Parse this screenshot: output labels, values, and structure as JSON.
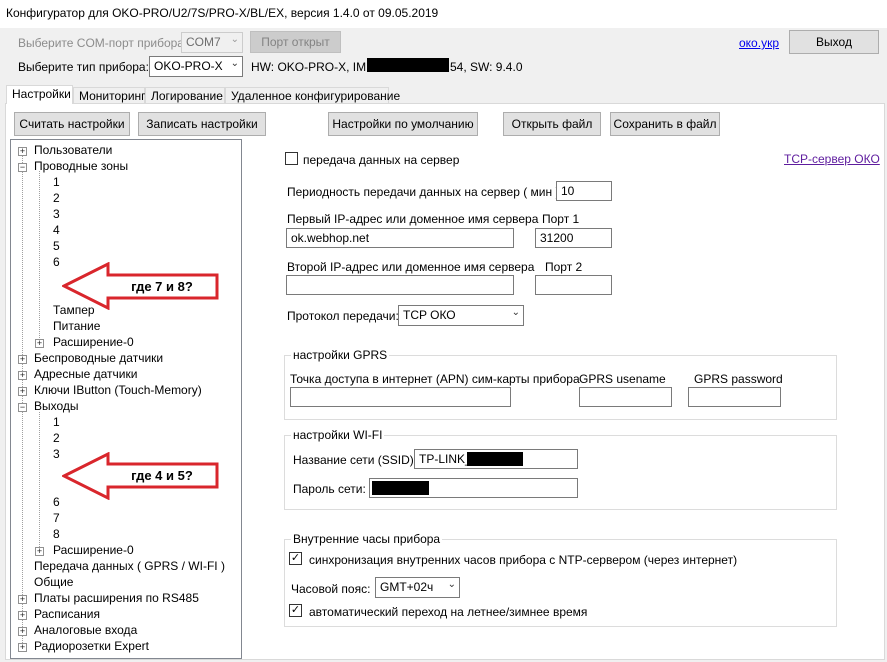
{
  "window": {
    "title": "Конфигуратор для OKO-PRO/U2/7S/PRO-X/BL/EX, версия 1.4.0 от 09.05.2019"
  },
  "header": {
    "com_label": "Выберите COM-порт прибора:",
    "com_value": "COM7",
    "port_button": "Порт открыт",
    "device_label": "Выберите тип прибора:",
    "device_value": "OKO-PRO-X",
    "hw_prefix": "HW: OKO-PRO-X, IMEI:",
    "hw_suffix": "54, SW: 9.4.0",
    "site_link": "око.укр",
    "exit_button": "Выход"
  },
  "tabs": [
    "Настройки",
    "Мониторинг",
    "Логирование",
    "Удаленное конфигурирование"
  ],
  "toolbar": {
    "read": "Считать настройки",
    "write": "Записать настройки",
    "defaults": "Настройки по умолчанию",
    "open": "Открыть файл",
    "save": "Сохранить в файл"
  },
  "tree": [
    {
      "label": "Пользователи",
      "expander": "+"
    },
    {
      "label": "Проводные зоны",
      "expander": "-"
    },
    {
      "label": "1"
    },
    {
      "label": "2"
    },
    {
      "label": "3"
    },
    {
      "label": "4"
    },
    {
      "label": "5"
    },
    {
      "label": "6"
    },
    {
      "label": ""
    },
    {
      "label": ""
    },
    {
      "label": "Тампер"
    },
    {
      "label": "Питание"
    },
    {
      "label": "Расширение-0",
      "expander": "+"
    },
    {
      "label": "Беспроводные датчики",
      "expander": "+"
    },
    {
      "label": "Адресные датчики",
      "expander": "+"
    },
    {
      "label": "Ключи IButton (Touch-Memory)",
      "expander": "+"
    },
    {
      "label": "Выходы",
      "expander": "-"
    },
    {
      "label": "1"
    },
    {
      "label": "2"
    },
    {
      "label": "3"
    },
    {
      "label": ""
    },
    {
      "label": ""
    },
    {
      "label": "6"
    },
    {
      "label": "7"
    },
    {
      "label": "8"
    },
    {
      "label": "Расширение-0",
      "expander": "+"
    },
    {
      "label": "Передача данных ( GPRS / WI-FI )"
    },
    {
      "label": "Общие"
    },
    {
      "label": "Платы расширения по RS485",
      "expander": "+"
    },
    {
      "label": "Расписания",
      "expander": "+"
    },
    {
      "label": "Аналоговые входа",
      "expander": "+"
    },
    {
      "label": "Радиорозетки Expert",
      "expander": "+"
    }
  ],
  "annotations": {
    "zones": "где 7 и 8?",
    "outputs": "где 4 и 5?",
    "color": "#d9262c"
  },
  "server": {
    "send_label": "передача данных на сервер",
    "send_checked": false,
    "tcp_link": "TCP-сервер ОКО",
    "period_label": "Периодность передачи данных на сервер ( мин ):",
    "period_value": "10",
    "ip1_label": "Первый IP-адрес или доменное имя сервера",
    "ip1_value": "ok.webhop.net",
    "port1_label": "Порт 1",
    "port1_value": "31200",
    "ip2_label": "Второй IP-адрес или доменное имя сервера",
    "ip2_value": "",
    "port2_label": "Порт 2",
    "port2_value": "",
    "protocol_label": "Протокол передачи:",
    "protocol_value": "TCP ОКО"
  },
  "gprs": {
    "title": "настройки GPRS",
    "apn_label": "Точка доступа в интернет (APN) сим-карты прибора",
    "apn_value": "",
    "user_label": "GPRS usename",
    "user_value": "",
    "pass_label": "GPRS password",
    "pass_value": ""
  },
  "wifi": {
    "title": "настройки WI-FI",
    "ssid_label": "Название сети (SSID):",
    "ssid_value": "TP-LINK_",
    "pass_label": "Пароль сети:"
  },
  "clock": {
    "title": "Внутренние часы прибора",
    "ntp_label": "синхронизация внутренних часов прибора с NTP-сервером (через интернет)",
    "ntp_checked": true,
    "tz_label": "Часовой пояс:",
    "tz_value": "GMT+02ч",
    "dst_label": "автоматический переход на летнее/зимнее время",
    "dst_checked": true
  }
}
